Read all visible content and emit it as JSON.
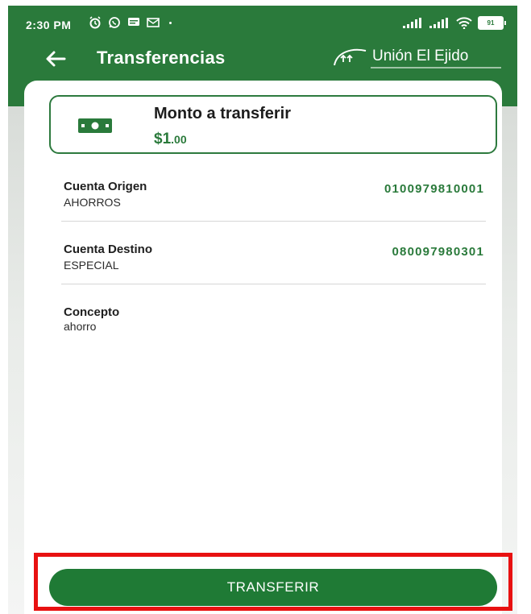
{
  "status_bar": {
    "time": "2:30 PM",
    "left_icons": [
      "alarm-icon",
      "whatsapp-icon",
      "message-icon",
      "mail-icon"
    ],
    "right_icons": [
      "signal-icon",
      "signal-icon",
      "wifi-icon",
      "battery-icon"
    ],
    "battery": "91"
  },
  "header": {
    "title": "Transferencias",
    "brand": "Unión El Ejido",
    "back_icon": "arrow-left-icon"
  },
  "amount": {
    "label": "Monto a transferir",
    "value_main": "$1",
    "value_cents": ".00",
    "icon": "cash-icon"
  },
  "details": [
    {
      "label": "Cuenta Origen",
      "sub": "AHORROS",
      "value": "0100979810001"
    },
    {
      "label": "Cuenta Destino",
      "sub": "ESPECIAL",
      "value": "080097980301"
    },
    {
      "label": "Concepto",
      "sub": "ahorro",
      "value": ""
    }
  ],
  "action": {
    "label": "TRANSFERIR"
  },
  "colors": {
    "brand_green": "#2a7a3b",
    "button_green": "#1f7a35",
    "highlight": "#e81111"
  }
}
